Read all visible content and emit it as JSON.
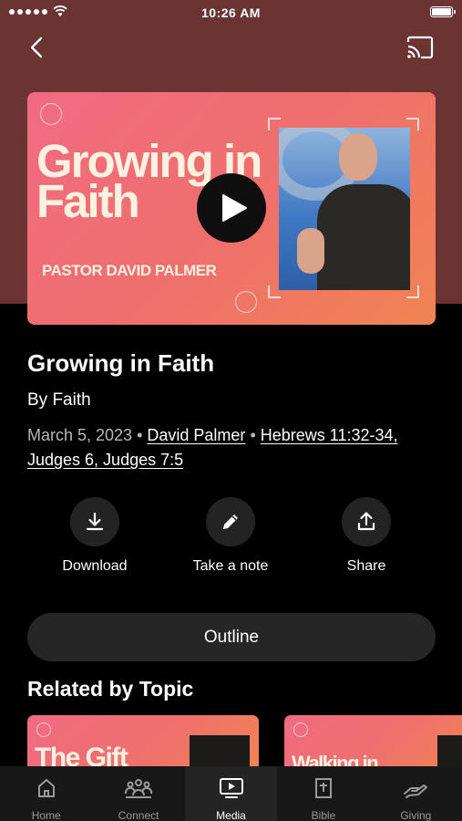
{
  "status_bar": {
    "time": "10:26 AM"
  },
  "hero": {
    "thumbnail_title": "Growing in Faith",
    "thumbnail_pastor": "PASTOR DAVID PALMER"
  },
  "sermon": {
    "title": "Growing in Faith",
    "series": "By Faith",
    "date": "March 5, 2023",
    "speaker": "David Palmer",
    "scripture": "Hebrews 11:32-34, Judges 6, Judges 7:5"
  },
  "actions": {
    "download_label": "Download",
    "note_label": "Take a note",
    "share_label": "Share"
  },
  "outline": {
    "label": "Outline"
  },
  "related": {
    "title": "Related by Topic",
    "cards": [
      {
        "title": "The Gift"
      },
      {
        "title": "Walking in"
      }
    ]
  },
  "tabs": [
    {
      "label": "Home",
      "icon": "home-icon"
    },
    {
      "label": "Connect",
      "icon": "people-icon"
    },
    {
      "label": "Media",
      "icon": "media-icon",
      "active": true
    },
    {
      "label": "Bible",
      "icon": "bible-icon"
    },
    {
      "label": "Giving",
      "icon": "giving-icon"
    }
  ],
  "colors": {
    "hero_background": "#6b3433",
    "thumbnail_gradient_start": "#f06b82",
    "thumbnail_gradient_end": "#f08452",
    "page_background": "#000000",
    "button_background": "#262626"
  }
}
